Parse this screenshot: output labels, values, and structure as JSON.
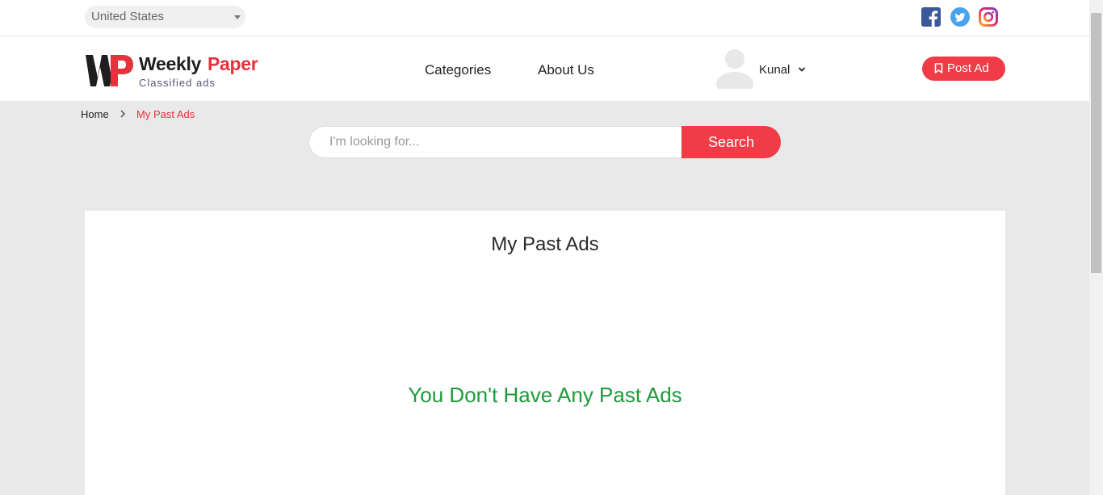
{
  "topbar": {
    "country": "United States",
    "social": [
      "facebook-icon",
      "twitter-icon",
      "instagram-icon"
    ]
  },
  "header": {
    "brand_part1": "Weekly",
    "brand_part2": "Paper",
    "brand_sub": "Classified ads",
    "nav": [
      "Categories",
      "About Us"
    ],
    "user_name": "Kunal",
    "post_button": "Post Ad"
  },
  "breadcrumb": {
    "home": "Home",
    "current": "My Past Ads"
  },
  "search": {
    "placeholder": "I'm looking for...",
    "button": "Search"
  },
  "main": {
    "title": "My Past Ads",
    "empty_message": "You Don't Have Any Past Ads"
  },
  "colors": {
    "accent": "#ef3c46",
    "success": "#1e9a3a",
    "background": "#e9e9e9"
  }
}
